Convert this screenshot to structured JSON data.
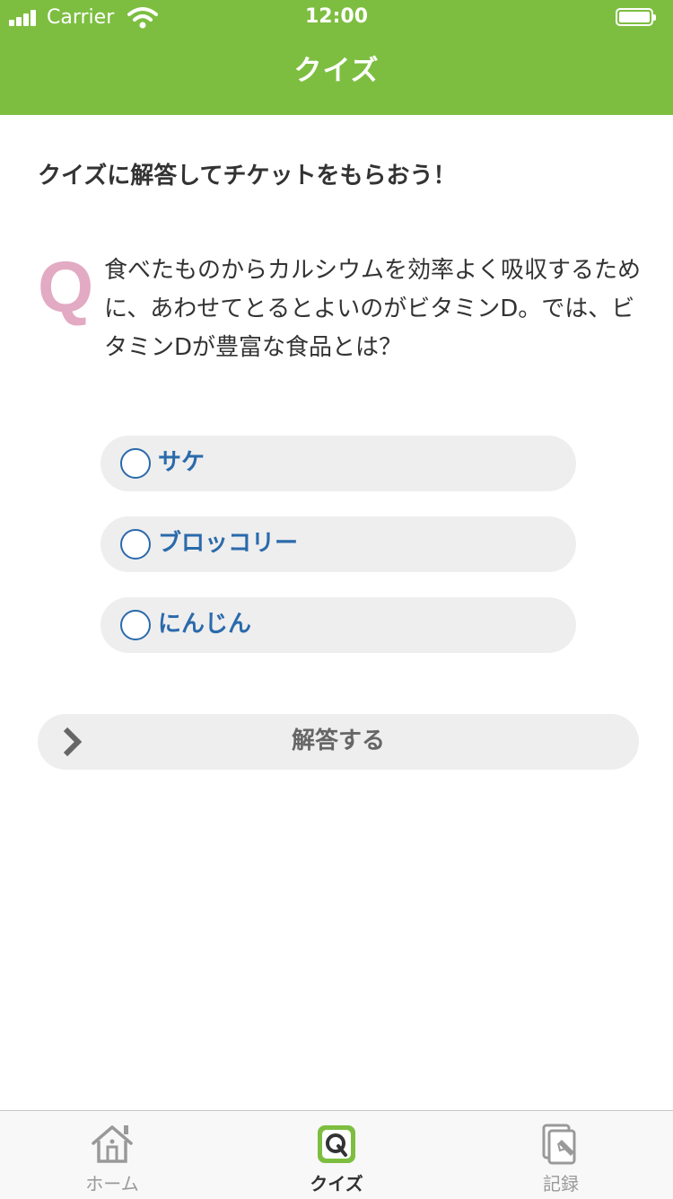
{
  "status_bar": {
    "carrier": "Carrier",
    "time": "12:00"
  },
  "nav": {
    "title": "クイズ"
  },
  "intro_text": "クイズに解答してチケットをもらおう！",
  "question": {
    "mark": "Q",
    "text": "食べたものからカルシウムを効率よく吸収するために、あわせてとるとよいのがビタミンD。では、ビタミンDが豊富な食品とは？"
  },
  "options": [
    {
      "label": "サケ",
      "selected": false
    },
    {
      "label": "ブロッコリー",
      "selected": false
    },
    {
      "label": "にんじん",
      "selected": false
    }
  ],
  "answer_button": {
    "label": "解答する"
  },
  "tabbar": {
    "items": [
      {
        "label": "ホーム",
        "icon": "home-icon",
        "active": false
      },
      {
        "label": "クイズ",
        "icon": "quiz-icon",
        "active": true
      },
      {
        "label": "記録",
        "icon": "record-icon",
        "active": false
      }
    ]
  },
  "colors": {
    "header_green": "#7dbe40",
    "option_blue": "#2a6aab",
    "q_pink": "#e2aac3",
    "pill_gray": "#eeeeee"
  }
}
